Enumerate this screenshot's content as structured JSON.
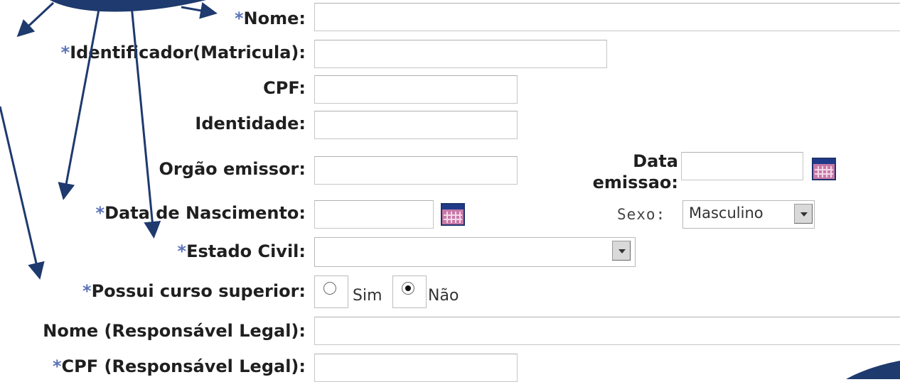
{
  "form": {
    "required_marker": "*",
    "fields": {
      "nome": {
        "label": "Nome:",
        "value": ""
      },
      "identificador": {
        "label": "Identificador(Matricula):",
        "value": ""
      },
      "cpf": {
        "label": "CPF:",
        "value": ""
      },
      "identidade": {
        "label": "Identidade:",
        "value": ""
      },
      "orgao_emissor": {
        "label": "Orgão emissor:",
        "value": ""
      },
      "data_emissao": {
        "label_line1": "Data",
        "label_line2": "emissao:",
        "value": ""
      },
      "data_nascimento": {
        "label": "Data de Nascimento:",
        "value": ""
      },
      "sexo": {
        "label": "Sexo:",
        "selected": "Masculino"
      },
      "estado_civil": {
        "label": "Estado Civil:",
        "selected": ""
      },
      "curso_superior": {
        "label": "Possui curso superior:",
        "options": [
          "Sim",
          "Não"
        ],
        "selected": "Não"
      },
      "nome_responsavel": {
        "label": "Nome (Responsável Legal):",
        "value": ""
      },
      "cpf_responsavel": {
        "label": "CPF (Responsável Legal):",
        "value": ""
      }
    }
  },
  "icons": {
    "calendar": "calendar-icon",
    "dropdown": "chevron-down-icon"
  },
  "colors": {
    "required_marker": "#5b73b8",
    "annotation_arrow": "#1e3a6e"
  }
}
